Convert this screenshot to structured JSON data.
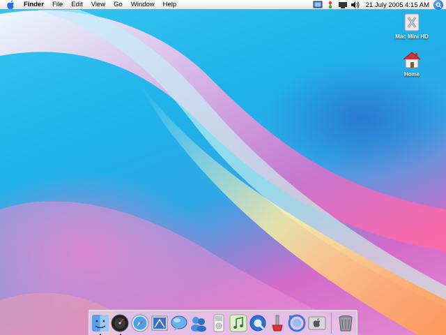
{
  "menubar": {
    "apple_icon": "apple-icon",
    "items": [
      "Finder",
      "File",
      "Edit",
      "View",
      "Go",
      "Window",
      "Help"
    ],
    "extras": [
      "display-icon",
      "network-icon",
      "battery-icon",
      "volume-icon"
    ],
    "clock": "21 July 2005 4:15 AM",
    "spotlight_icon": "spotlight-icon"
  },
  "desktop": {
    "icons": [
      {
        "label": "Mac Mini HD",
        "icon": "hard-drive-icon"
      },
      {
        "label": "Home",
        "icon": "home-icon"
      }
    ]
  },
  "dock": {
    "apps": [
      {
        "name": "Finder",
        "icon": "finder-icon",
        "running": true
      },
      {
        "name": "Dashboard",
        "icon": "dashboard-icon",
        "running": true
      },
      {
        "name": "Safari",
        "icon": "safari-icon",
        "running": false
      },
      {
        "name": "Mail",
        "icon": "mail-icon",
        "running": false
      },
      {
        "name": "iChat",
        "icon": "ichat-icon",
        "running": false
      },
      {
        "name": "Address Book",
        "icon": "addressbook-icon",
        "running": false
      },
      {
        "name": "iPod",
        "icon": "ipod-icon",
        "running": false
      },
      {
        "name": "iTunes",
        "icon": "itunes-icon",
        "running": false
      },
      {
        "name": "QuickTime",
        "icon": "quicktime-icon",
        "running": false
      },
      {
        "name": "Utility",
        "icon": "utility-icon",
        "running": false
      },
      {
        "name": "Sync",
        "icon": "sync-icon",
        "running": false
      },
      {
        "name": "System Preferences",
        "icon": "system-preferences-icon",
        "running": false
      }
    ],
    "trash_icon": "trash-icon"
  },
  "colors": {
    "wallpaper_blue": "#1fb2ea",
    "wallpaper_pink": "#e48ad2"
  }
}
